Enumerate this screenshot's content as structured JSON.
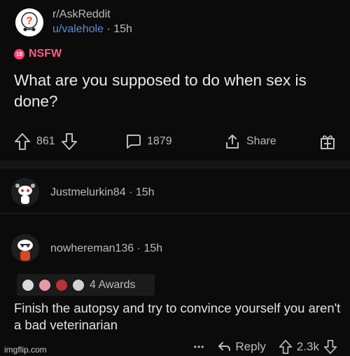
{
  "post": {
    "subreddit": "r/AskReddit",
    "author": "u/valehole",
    "separator": "·",
    "age": "15h",
    "nsfw_label": "NSFW",
    "nsfw_badge": "18",
    "title": "What are you supposed to do when sex is done?",
    "upvotes": "861",
    "comments": "1879",
    "share_label": "Share"
  },
  "comments": [
    {
      "author": "Justmelurkin84",
      "age": "15h"
    },
    {
      "author": "nowhereman136",
      "age": "15h",
      "awards": "4 Awards",
      "body": "Finish the autopsy and try to convince yourself you aren't a bad veterinarian",
      "more": "•••",
      "reply_label": "Reply",
      "votes": "2.3k"
    }
  ],
  "watermark": "imgflip.com",
  "colors": {
    "background": "#0b0b0b",
    "nsfw": "#ff5a8a",
    "author": "#5b8dd6",
    "text": "#d7dadc"
  }
}
